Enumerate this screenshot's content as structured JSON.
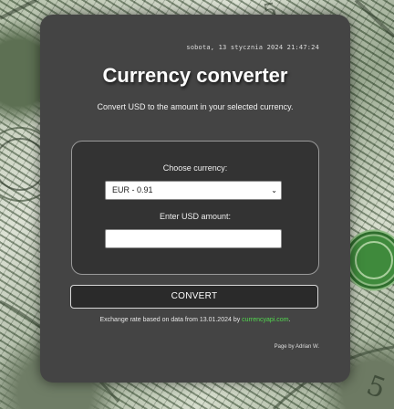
{
  "page": {
    "datetime": "sobota, 13 stycznia 2024 21:47:24",
    "title": "Currency converter",
    "description": "Convert USD to the amount in your selected currency."
  },
  "form": {
    "choose_label": "Choose currency:",
    "currency_selected": "EUR - 0.91",
    "amount_label": "Enter USD amount:",
    "amount_value": "",
    "convert_label": "CONVERT"
  },
  "footer": {
    "rate_note_prefix": "Exchange rate based on data from 13.01.2024 by ",
    "rate_note_link": "currencyapi.com",
    "rate_note_suffix": ".",
    "credit": "Page by Adrian W."
  },
  "icons": {
    "select_arrow": "chevron-down-icon"
  },
  "colors": {
    "card_bg": "#444444",
    "inner_bg": "#333333",
    "link": "#52d84f"
  }
}
